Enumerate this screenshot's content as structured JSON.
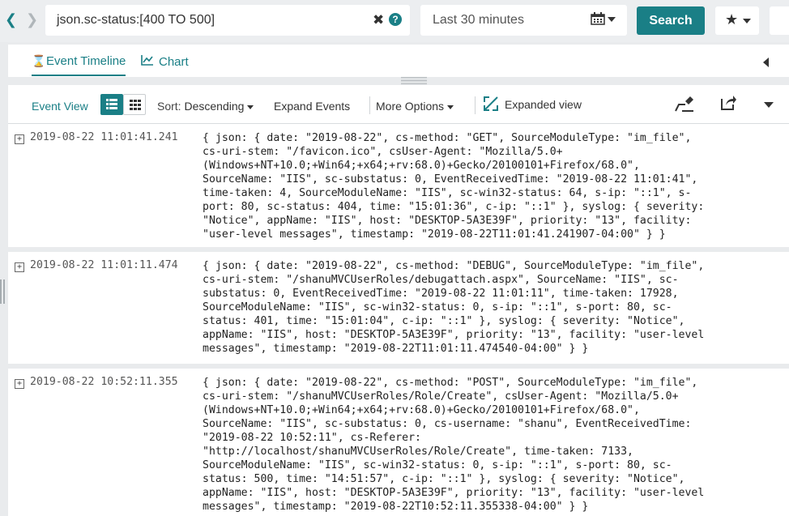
{
  "search": {
    "query": "json.sc-status:[400 TO 500]",
    "time_range": "Last 30 minutes",
    "search_label": "Search"
  },
  "tabs": {
    "timeline_label": "Event Timeline",
    "chart_label": "Chart"
  },
  "toolbar": {
    "event_view_label": "Event View",
    "sort_prefix": "Sort: ",
    "sort_value": "Descending",
    "expand_events_label": "Expand Events",
    "more_options_label": "More Options",
    "expanded_view_label": "Expanded view"
  },
  "colors": {
    "accent": "#1a7f86",
    "highlight": "#fbefb2",
    "number": "#3344bb"
  },
  "events": [
    {
      "timestamp": "2019-08-22 11:01:41.241",
      "lines": [
        "{ json: { date: \"2019-08-22\", cs-method: \"GET\", SourceModuleType: \"im_file\",",
        "cs-uri-stem: \"/favicon.ico\", csUser-Agent: \"Mozilla/5.0+",
        "(Windows+NT+10.0;+Win64;+x64;+rv:68.0)+Gecko/20100101+Firefox/68.0\",",
        "SourceName: \"IIS\", sc-substatus: 0, EventReceivedTime: \"2019-08-22 11:01:41\",",
        "time-taken: 4, SourceModuleName: \"IIS\", sc-win32-status: 64, s-ip: \"::1\", s-",
        "port: 80, sc-status: 404, time: \"15:01:36\", c-ip: \"::1\" }, syslog: { severity:",
        "\"Notice\", appName: \"IIS\", host: \"DESKTOP-5A3E39F\", priority: \"13\", facility:",
        "\"user-level messages\", timestamp: \"2019-08-22T11:01:41.241907-04:00\" } }"
      ]
    },
    {
      "timestamp": "2019-08-22 11:01:11.474",
      "lines": [
        "{ json: { date: \"2019-08-22\", cs-method: \"DEBUG\", SourceModuleType: \"im_file\",",
        "cs-uri-stem: \"/shanuMVCUserRoles/debugattach.aspx\", SourceName: \"IIS\", sc-",
        "substatus: 0, EventReceivedTime: \"2019-08-22 11:01:11\", time-taken: 17928,",
        "SourceModuleName: \"IIS\", sc-win32-status: 0, s-ip: \"::1\", s-port: 80, sc-",
        "status: 401, time: \"15:01:04\", c-ip: \"::1\" }, syslog: { severity: \"Notice\",",
        "appName: \"IIS\", host: \"DESKTOP-5A3E39F\", priority: \"13\", facility: \"user-level",
        "messages\", timestamp: \"2019-08-22T11:01:11.474540-04:00\" } }"
      ]
    },
    {
      "timestamp": "2019-08-22 10:52:11.355",
      "lines": [
        "{ json: { date: \"2019-08-22\", cs-method: \"POST\", SourceModuleType: \"im_file\",",
        "cs-uri-stem: \"/shanuMVCUserRoles/Role/Create\", csUser-Agent: \"Mozilla/5.0+",
        "(Windows+NT+10.0;+Win64;+x64;+rv:68.0)+Gecko/20100101+Firefox/68.0\",",
        "SourceName: \"IIS\", sc-substatus: 0, cs-username: \"shanu\", EventReceivedTime:",
        "\"2019-08-22 10:52:11\", cs-Referer:",
        "\"http://localhost/shanuMVCUserRoles/Role/Create\", time-taken: 7133,",
        "SourceModuleName: \"IIS\", sc-win32-status: 0, s-ip: \"::1\", s-port: 80, sc-",
        "status: 500, time: \"14:51:57\", c-ip: \"::1\" }, syslog: { severity: \"Notice\",",
        "appName: \"IIS\", host: \"DESKTOP-5A3E39F\", priority: \"13\", facility: \"user-level",
        "messages\", timestamp: \"2019-08-22T10:52:11.355338-04:00\" } }"
      ]
    }
  ]
}
